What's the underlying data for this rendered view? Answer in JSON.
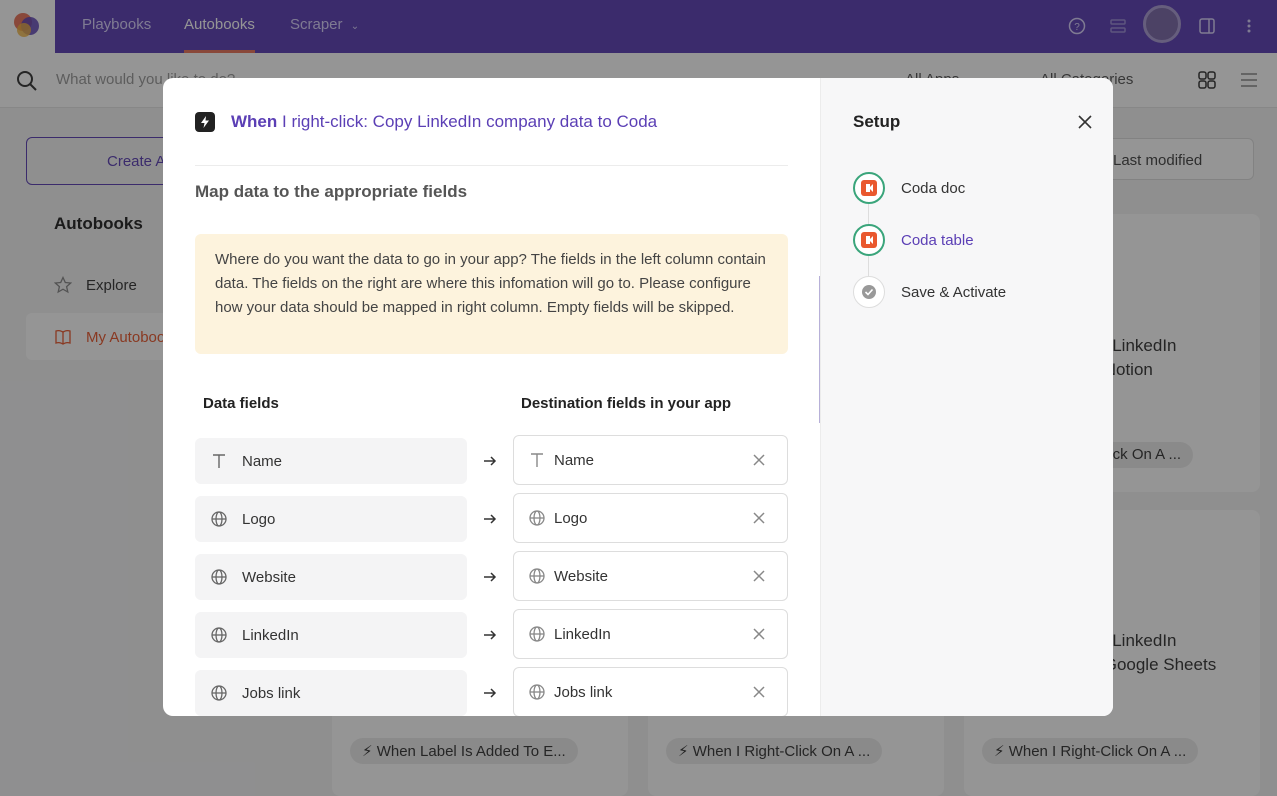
{
  "nav": {
    "tabs": [
      "Playbooks",
      "Autobooks",
      "Scraper"
    ],
    "active_tab": "Autobooks"
  },
  "search": {
    "placeholder": "What would you like to do?",
    "filter_apps": "All Apps",
    "filter_categories": "All Categories"
  },
  "background": {
    "create_button": "Create A",
    "sidebar_title": "Autobooks",
    "sidebar_items": [
      "Explore",
      "My Autobooks"
    ],
    "sort_label": "Last modified",
    "card_texts": [
      "y LinkedIn\n Notion",
      "y LinkedIn\n Google Sheets"
    ],
    "pills": [
      "lick On A ...",
      "When Label Is Added To E...",
      "When I Right-Click On A ...",
      "When I Right-Click On A ..."
    ]
  },
  "modal": {
    "title_prefix": "When",
    "title_rest": " I right-click: Copy LinkedIn company data to Coda",
    "subtitle": "Map data to the appropriate fields",
    "notice": "Where do you want the data to go in your app? The fields in the left column contain data. The fields on the right are where this infomation will go to. Please configure how your data should be mapped in right column. Empty fields will be skipped.",
    "col_data": "Data fields",
    "col_dest": "Destination fields in your app",
    "mappings": [
      {
        "source": "Name",
        "dest": "Name",
        "icon": "text-icon"
      },
      {
        "source": "Logo",
        "dest": "Logo",
        "icon": "globe-icon"
      },
      {
        "source": "Website",
        "dest": "Website",
        "icon": "globe-icon"
      },
      {
        "source": "LinkedIn",
        "dest": "LinkedIn",
        "icon": "globe-icon"
      },
      {
        "source": "Jobs link",
        "dest": "Jobs link",
        "icon": "globe-icon"
      }
    ]
  },
  "setup": {
    "title": "Setup",
    "steps": [
      {
        "label": "Coda doc",
        "state": "done"
      },
      {
        "label": "Coda table",
        "state": "current"
      },
      {
        "label": "Save & Activate",
        "state": "pending"
      }
    ]
  },
  "colors": {
    "accent": "#5b3fb5",
    "coda": "#e9582e",
    "done": "#3aa57b",
    "notice_bg": "#fdf3dd"
  }
}
